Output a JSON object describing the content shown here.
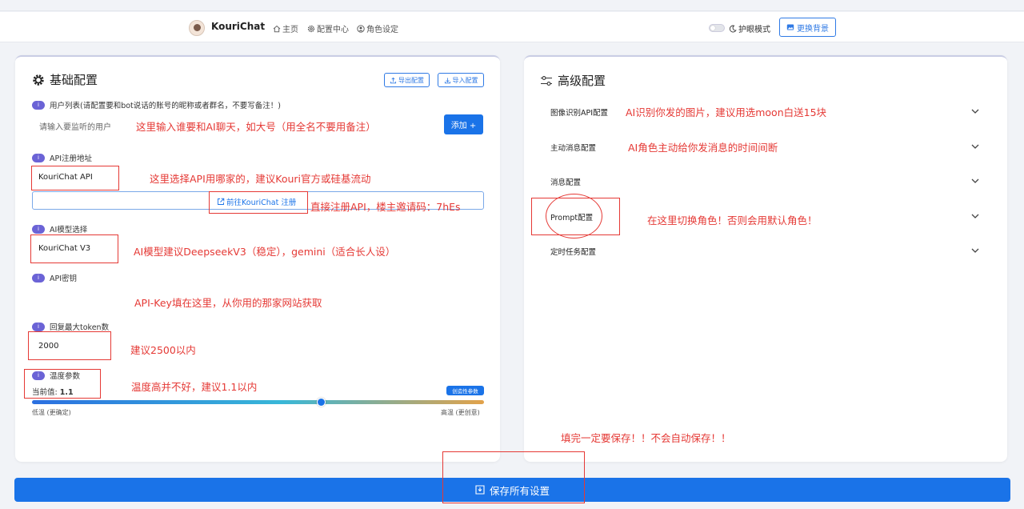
{
  "navbar": {
    "brand": "KouriChat",
    "items": [
      {
        "label": "主页",
        "icon": "home-icon"
      },
      {
        "label": "配置中心",
        "icon": "gear-icon"
      },
      {
        "label": "角色设定",
        "icon": "user-circle-icon"
      }
    ],
    "eye_mode_label": "护眼模式",
    "eye_mode_on": false,
    "change_bg_label": "更换背景"
  },
  "basic": {
    "title": "基础配置",
    "export_label": "导出配置",
    "import_label": "导入配置",
    "user_list_label": "用户列表(请配置要和bot说话的账号的昵称或者群名，不要写备注！)",
    "user_input_placeholder": "请输入要监听的用户",
    "add_label": "添加 +",
    "api_url_label": "API注册地址",
    "api_url_value": "KouriChat API",
    "register_link": "前往KouriChat 注册",
    "model_label": "AI模型选择",
    "model_value": "KouriChat V3",
    "key_label": "API密钥",
    "token_label": "回复最大token数",
    "token_value": "2000",
    "temp_label": "温度参数",
    "temp_current_prefix": "当前值:",
    "temp_current_value": "1.1",
    "temp_badge": "创造性参数",
    "temp_level": 0.64,
    "temp_low": "低温 (更确定)",
    "temp_high": "高温 (更创意)"
  },
  "advanced": {
    "title": "高级配置",
    "items": [
      "图像识别API配置",
      "主动消息配置",
      "消息配置",
      "Prompt配置",
      "定时任务配置"
    ]
  },
  "annotations": {
    "user_list": "这里输入谁要和AI聊天，如大号（用全名不要用备注）",
    "api_url": "这里选择API用哪家的，建议Kouri官方或硅基流动",
    "register": "直接注册API，楼主邀请码：7hEs",
    "model": "AI模型建议DeepseekV3（稳定），gemini（适合长人设）",
    "key": "API-Key填在这里，从你用的那家网站获取",
    "token": "建议2500以内",
    "temp": "温度高并不好，建议1.1以内",
    "image_api": "AI识别你发的图片，建议用选moon白送15块",
    "active_msg": "AI角色主动给你发消息的时间间断",
    "prompt": "在这里切换角色！否则会用默认角色！",
    "save": "填完一定要保存！！不会自动保存！！"
  },
  "save_label": "保存所有设置"
}
